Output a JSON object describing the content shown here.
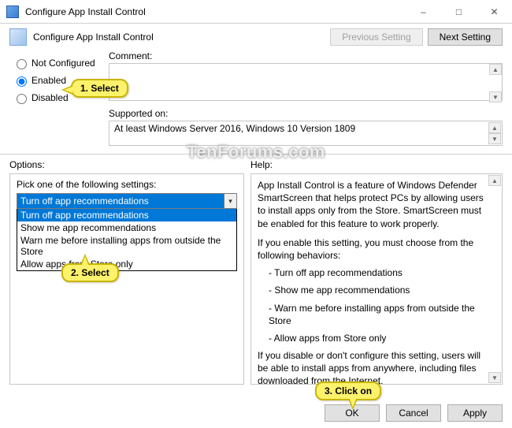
{
  "window": {
    "title": "Configure App Install Control"
  },
  "header": {
    "title": "Configure App Install Control",
    "prev": "Previous Setting",
    "next": "Next Setting"
  },
  "radios": {
    "not_configured": "Not Configured",
    "enabled": "Enabled",
    "disabled": "Disabled"
  },
  "labels": {
    "comment": "Comment:",
    "supported": "Supported on:",
    "options": "Options:",
    "help": "Help:",
    "pick": "Pick one of the following settings:"
  },
  "supported_text": "At least Windows Server 2016, Windows 10 Version 1809",
  "dropdown": {
    "selected": "Turn off app recommendations",
    "items": [
      "Turn off app recommendations",
      "Show me app recommendations",
      "Warn me before installing apps from outside the Store",
      "Allow apps from Store only"
    ]
  },
  "help": {
    "p1": "App Install Control is a feature of Windows Defender SmartScreen that helps protect PCs by allowing users to install apps only from the Store. SmartScreen must be enabled for this feature to work properly.",
    "p2": "If you enable this setting, you must choose from the following behaviors:",
    "b1": "Turn off app recommendations",
    "b2": "Show me app recommendations",
    "b3": "Warn me before installing apps from outside the Store",
    "b4": "Allow apps from Store only",
    "p3": "If you disable or don't configure this setting, users will be able to install apps from anywhere, including files downloaded from the Internet."
  },
  "buttons": {
    "ok": "OK",
    "cancel": "Cancel",
    "apply": "Apply"
  },
  "callouts": {
    "c1": "1. Select",
    "c2": "2. Select",
    "c3": "3. Click on"
  },
  "watermark": "TenForums.com"
}
